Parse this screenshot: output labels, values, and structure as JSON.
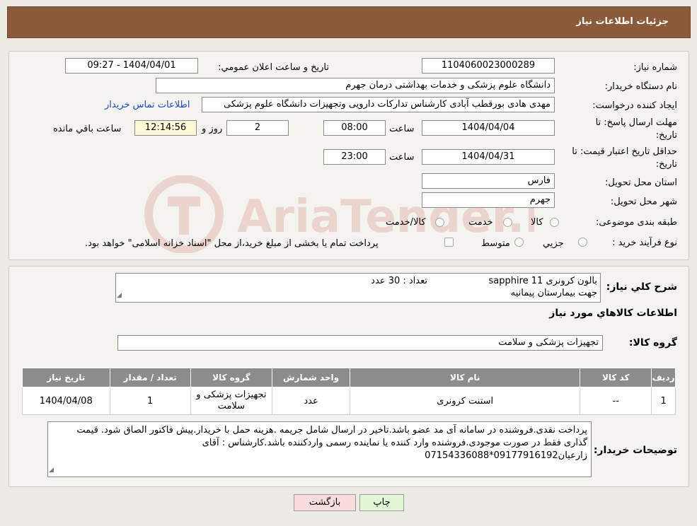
{
  "header": {
    "title": "جزئیات اطلاعات نیاز"
  },
  "form": {
    "need_number": {
      "label": "شماره نیاز:",
      "value": "1104060023000289"
    },
    "announce_datetime": {
      "label": "تاریخ و ساعت اعلان عمومي:",
      "value": "1404/04/01 - 09:27"
    },
    "buyer_org": {
      "label": "نام دستگاه خریدار:",
      "value": "دانشگاه علوم پزشکی و خدمات بهداشتی  درمان جهرم"
    },
    "requester": {
      "label": "ایجاد کننده درخواست:",
      "value": "مهدی هادی بورقطب آبادی کارشناس تدارکات دارویی وتجهیزات دانشگاه علوم پزشکی",
      "contact_link": "اطلاعات تماس خریدار"
    },
    "reply_deadline": {
      "label_line1": "مهلت ارسال پاسخ: تا",
      "label_line2": "تاریخ:",
      "date": "1404/04/04",
      "time_label": "ساعت",
      "time": "08:00",
      "days": "2",
      "days_label": "روز و",
      "remaining": "12:14:56",
      "remaining_label": "ساعت باقي مانده"
    },
    "price_validity": {
      "label_line1": "حداقل تاریخ اعتبار قیمت: تا",
      "label_line2": "تاریخ:",
      "date": "1404/04/31",
      "time_label": "ساعت",
      "time": "23:00"
    },
    "delivery_province": {
      "label": "استان محل تحویل:",
      "value": "فارس"
    },
    "delivery_city": {
      "label": "شهر محل تحویل:",
      "value": "جهرم"
    },
    "category": {
      "label": "طبقه بندی موضوعی:",
      "options": [
        "کالا",
        "خدمت",
        "کالا/خدمت"
      ]
    },
    "purchase_type": {
      "label": "نوع فرآیند خرید :",
      "options": [
        "جزیي",
        "متوسط"
      ],
      "note": "پرداخت تمام یا بخشی از مبلغ خرید،از محل \"اسناد خزانه اسلامی\" خواهد بود."
    }
  },
  "summary": {
    "label": "شرح کلي نیاز:",
    "line1_item": "بالون کرونری  sapphire 11",
    "line1_qty": "تعداد : 30 عدد",
    "line2": "جهت بیمارستان پیمانیه"
  },
  "goods_info": {
    "title": "اطلاعات کالاهاي مورد نیاز"
  },
  "goods_group": {
    "label": "گروه کالا:",
    "value": "تجهیزات پزشکی و سلامت"
  },
  "table": {
    "headers": [
      "ردیف",
      "کد کالا",
      "نام کالا",
      "واحد شمارش",
      "گروه کالا",
      "تعداد / مقدار",
      "تاریخ نیاز"
    ],
    "rows": [
      [
        "1",
        "--",
        "استنت کرونری",
        "عدد",
        "تجهیزات پزشکی و سلامت",
        "1",
        "1404/04/08"
      ]
    ]
  },
  "buyer_notes": {
    "label": "توضیحات خریدار:",
    "text": "پرداخت نقدی.فروشنده در سامانه آی مد عضو باشد.تاخیر در ارسال شامل جریمه .هزینه حمل با خریدار.پیش فاکتور الصاق شود. قیمت گذاری فقط در صورت موجودی.فروشنده وارد کننده یا نماینده رسمی واردکننده باشد.کارشناس : آقای زارعیان09177916192*07154336088"
  },
  "buttons": {
    "print": "چاپ",
    "back": "بازگشت"
  },
  "colors": {
    "header_bg": "#8b5a3a",
    "link": "#1a49c6",
    "print_btn": "#e3f7d6",
    "back_btn": "#fbdcdc"
  }
}
